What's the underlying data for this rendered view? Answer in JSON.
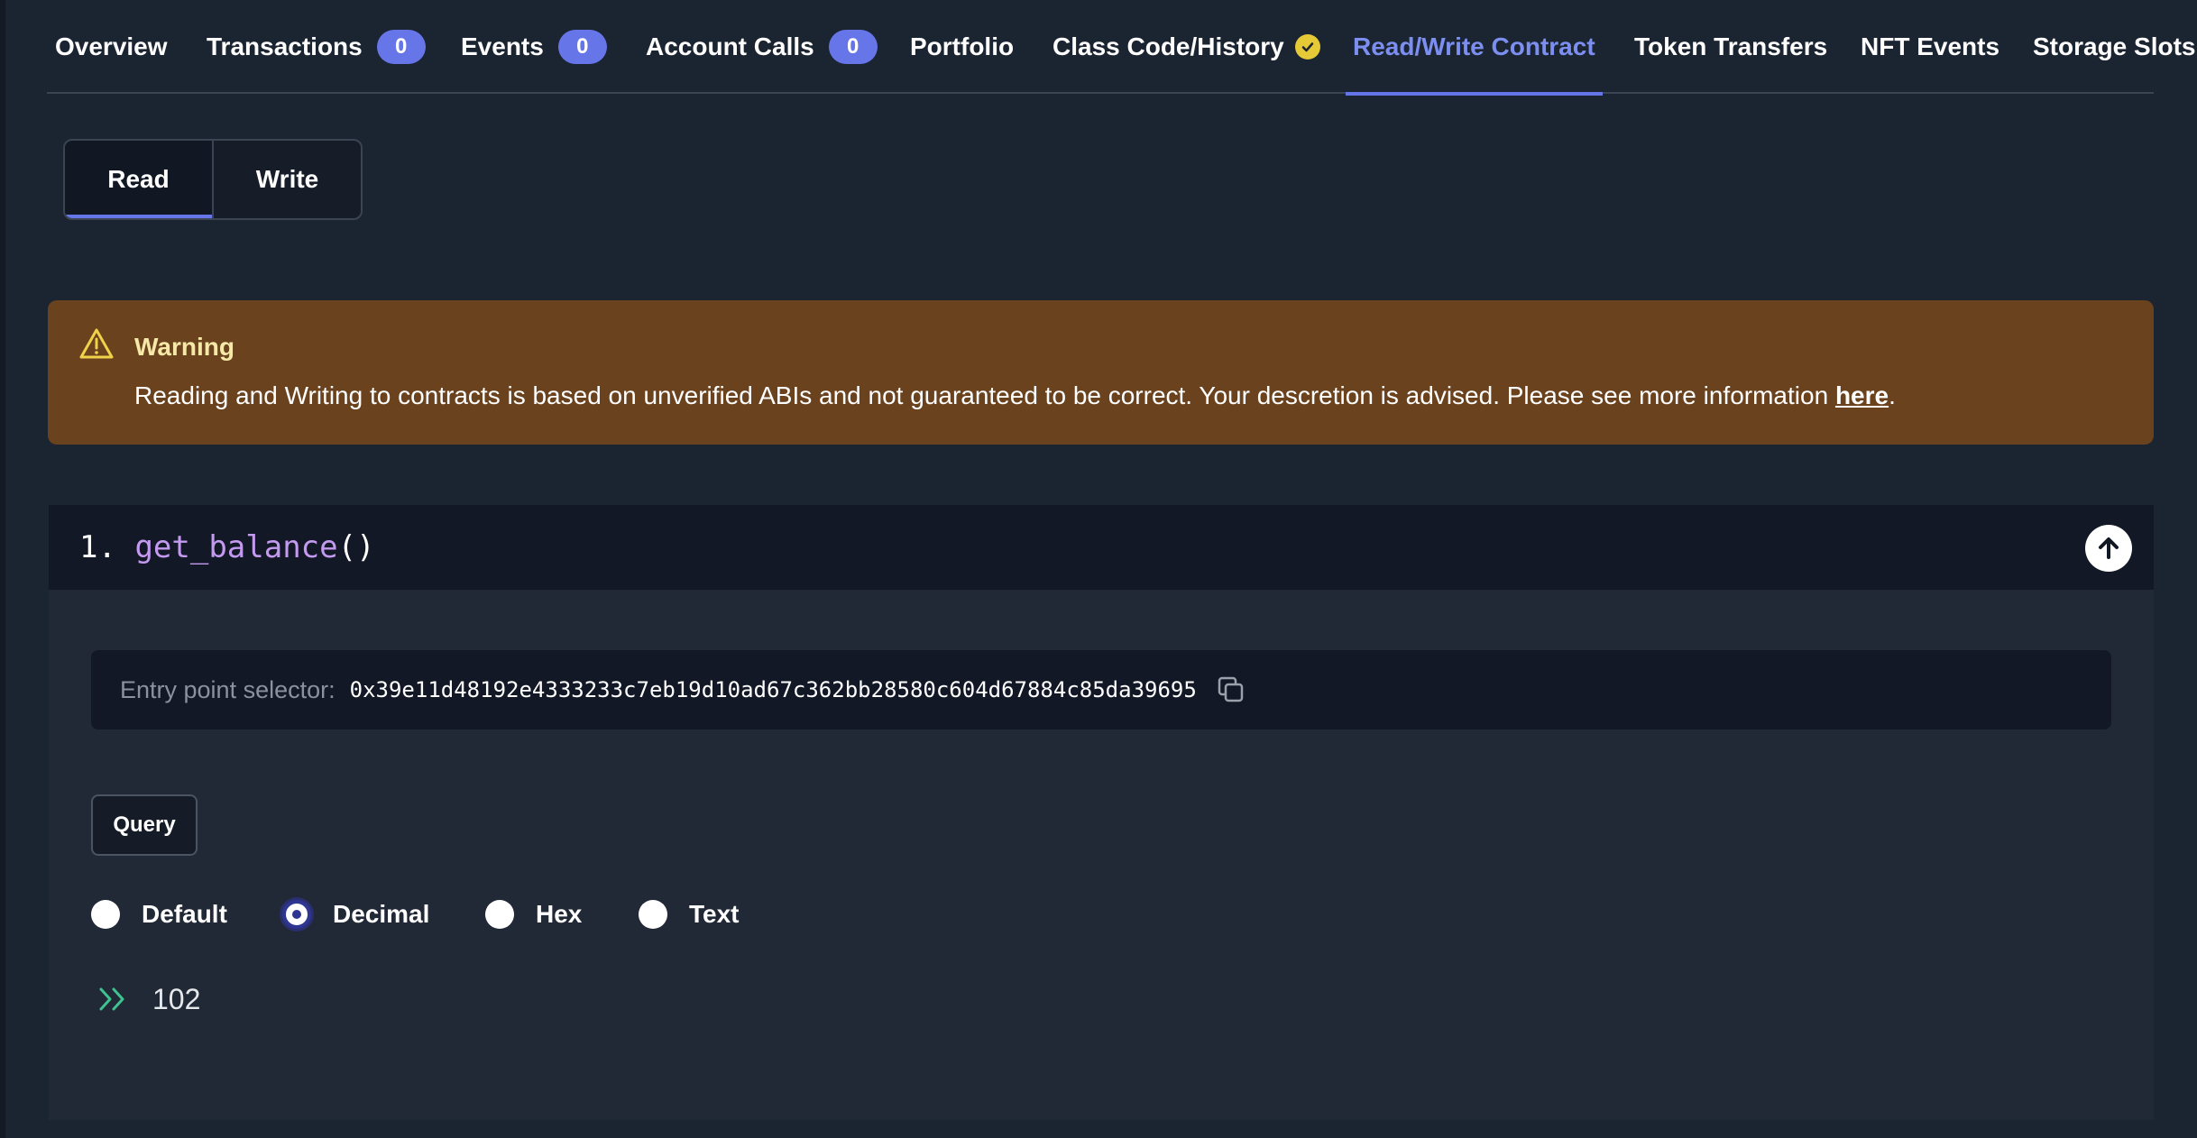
{
  "tabs": [
    {
      "label": "Overview"
    },
    {
      "label": "Transactions",
      "count": "0"
    },
    {
      "label": "Events",
      "count": "0"
    },
    {
      "label": "Account Calls",
      "count": "0"
    },
    {
      "label": "Portfolio"
    },
    {
      "label": "Class Code/History",
      "icon": "verified-check-icon"
    },
    {
      "label": "Read/Write Contract",
      "active": true
    },
    {
      "label": "Token Transfers"
    },
    {
      "label": "NFT Events"
    },
    {
      "label": "Storage Slots"
    }
  ],
  "mode_toggle": {
    "read": "Read",
    "write": "Write",
    "selected": "Read"
  },
  "warning": {
    "title": "Warning",
    "text": "Reading and Writing to contracts is based on unverified ABIs and not guaranteed to be correct. Your descretion is advised. Please see more information ",
    "link": "here",
    "end": "."
  },
  "function": {
    "index": "1.",
    "name": "get_balance",
    "parens": "()",
    "selector_label": "Entry point selector:",
    "selector_value": "0x39e11d48192e4333233c7eb19d10ad67c362bb28580c604d67884c85da39695",
    "query_label": "Query",
    "formats": [
      "Default",
      "Decimal",
      "Hex",
      "Text"
    ],
    "selected_format": "Decimal",
    "result": "102"
  },
  "colors": {
    "accent": "#6675e8",
    "warning_bg": "#6b421e",
    "function_name": "#c49af0",
    "result_icon": "#3ec28f"
  }
}
